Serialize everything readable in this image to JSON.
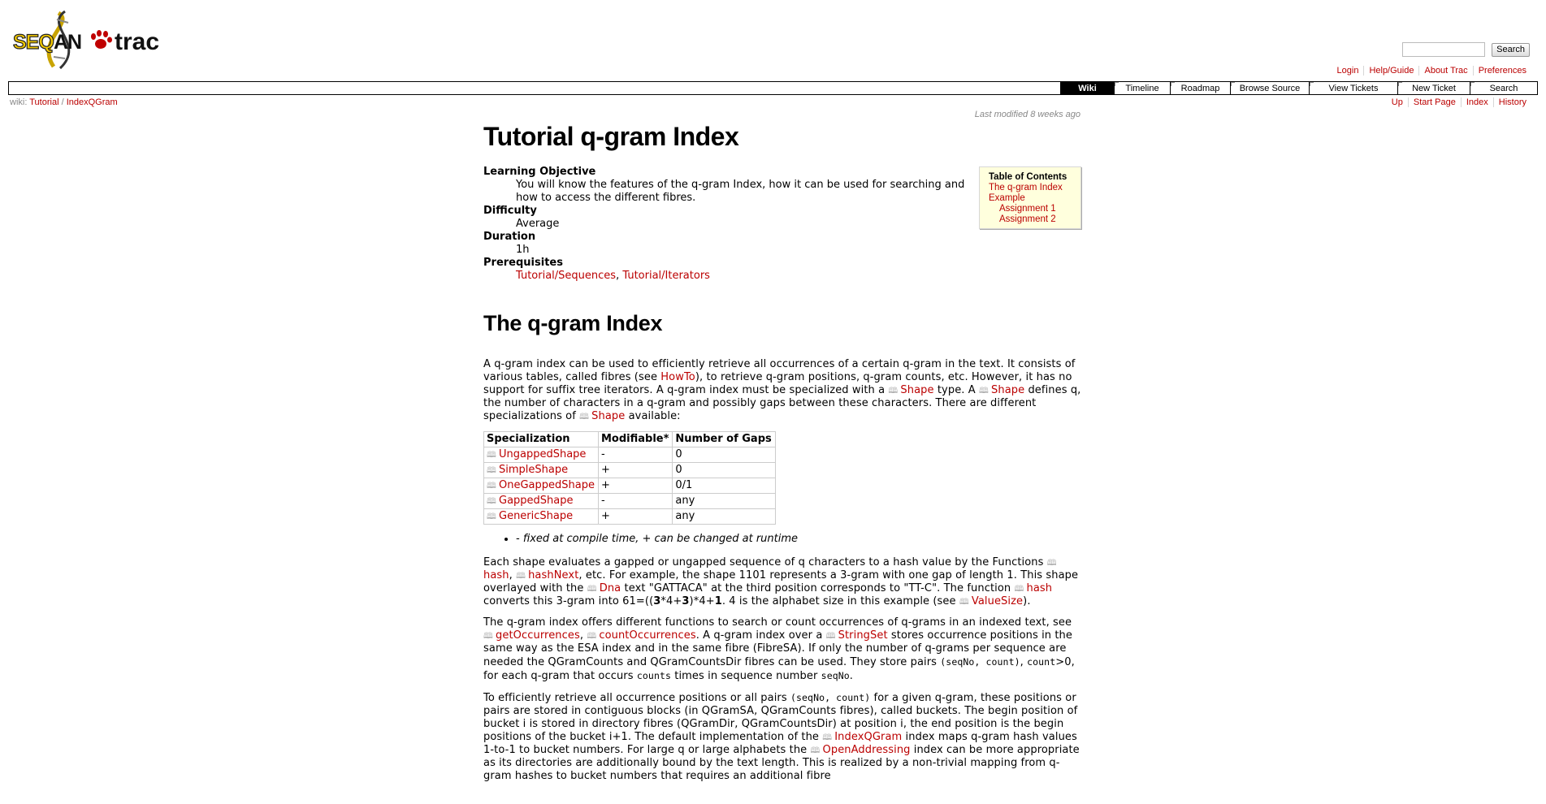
{
  "header": {
    "logo": {
      "text_left": "SEQAN",
      "text_right": "trac"
    },
    "search": {
      "placeholder": "",
      "button": "Search"
    },
    "metanav": [
      "Login",
      "Help/Guide",
      "About Trac",
      "Preferences"
    ],
    "mainnav": [
      {
        "label": "Wiki",
        "active": true
      },
      {
        "label": "Timeline"
      },
      {
        "label": "Roadmap"
      },
      {
        "label": "Browse Source"
      },
      {
        "label": "View Tickets"
      },
      {
        "label": "New Ticket"
      },
      {
        "label": "Search"
      }
    ],
    "breadcrumb": {
      "prefix": "wiki:",
      "path1": "Tutorial",
      "sep": "/",
      "path2": "IndexQGram"
    },
    "ctxnav": [
      "Up",
      "Start Page",
      "Index",
      "History"
    ],
    "last_modified": "Last modified 8 weeks ago"
  },
  "page": {
    "title": "Tutorial q-gram Index",
    "meta": {
      "learning_label": "Learning Objective",
      "learning_text": "You will know the features of the q-gram Index, how it can be used for searching and how to access the different fibres.",
      "difficulty_label": "Difficulty",
      "difficulty": "Average",
      "duration_label": "Duration",
      "duration": "1h",
      "prereq_label": "Prerequisites",
      "prereq_1": "Tutorial/Sequences",
      "prereq_sep": ",",
      "prereq_2": "Tutorial/Iterators"
    },
    "toc": {
      "title": "Table of Contents",
      "items": [
        "The q-gram Index",
        "Example",
        "Assignment 1",
        "Assignment 2"
      ]
    },
    "section_title": "The q-gram Index",
    "p1": {
      "t1": "A q-gram index can be used to efficiently retrieve all occurrences of a certain q-gram in the text. It consists of various tables, called fibres (see ",
      "link_howto": "HowTo",
      "t2": "), to retrieve q-gram positions, q-gram counts, etc. However, it has no support for suffix tree iterators. A q-gram index must be specialized with a ",
      "link_shape": "Shape",
      "t3": " type. A ",
      "t4": " defines q, the number of characters in a q-gram and possibly gaps between these characters. There are different specializations of ",
      "t5": " available:"
    },
    "table": {
      "headers": [
        "Specialization",
        "Modifiable*",
        "Number of Gaps"
      ],
      "rows": [
        [
          "UngappedShape",
          "-",
          "0"
        ],
        [
          "SimpleShape",
          "+",
          "0"
        ],
        [
          "OneGappedShape",
          "+",
          "0/1"
        ],
        [
          "GappedShape",
          "-",
          "any"
        ],
        [
          "GenericShape",
          "+",
          "any"
        ]
      ]
    },
    "note": "- fixed at compile time, + can be changed at runtime",
    "p2": {
      "t1": "Each shape evaluates a gapped or ungapped sequence of q characters to a hash value by the Functions ",
      "link_hash": "hash",
      "comma": ",",
      "link_hashnext": "hashNext",
      "t2": ", etc. For example, the shape 1101 represents a 3-gram with one gap of length 1. This shape overlayed with the ",
      "link_dna": "Dna",
      "t3": " text \"GATTACA\" at the third position corresponds to \"TT-C\". The function ",
      "t4": " converts this 3-gram into 61=((",
      "b1": "3",
      "t5": "*4+",
      "b2": "3",
      "t6": ")*4+",
      "b3": "1",
      "t7": ". 4 is the alphabet size in this example (see ",
      "link_valuesize": "ValueSize",
      "t8": ")."
    },
    "p3": {
      "t1": "The q-gram index offers different functions to search or count occurrences of q-grams in an indexed text, see ",
      "link_getocc": "getOccurrences",
      "comma": ",",
      "link_countocc": "countOccurrences",
      "t2": ". A q-gram index over a ",
      "link_stringset": "StringSet",
      "t3": " stores occurrence positions in the same way as the ESA index and in the same fibre (FibreSA). If only the number of q-grams per sequence are needed the QGramCounts and QGramCountsDir fibres can be used. They store pairs ",
      "c1": "(seqNo, count)",
      "t4": ", ",
      "c2": "count",
      "t5": ">0, for each q-gram that occurs ",
      "c3": "counts",
      "t6": " times in sequence number ",
      "c4": "seqNo",
      "t7": "."
    },
    "p4": {
      "t1": "To efficiently retrieve all occurrence positions or all pairs ",
      "c1": "(seqNo, count)",
      "t2": " for a given q-gram, these positions or pairs are stored in contiguous blocks (in QGramSA, QGramCounts fibres), called buckets. The begin position of bucket i is stored in directory fibres (QGramDir, QGramCountsDir) at position i, the end position is the begin positions of the bucket i+1. The default implementation of the ",
      "link_indexqgram": "IndexQGram",
      "t3": " index maps q-gram hash values 1-to-1 to bucket numbers. For large q or large alphabets the ",
      "link_openaddr": "OpenAddressing",
      "t4": " index can be more appropriate as its directories are additionally bound by the text length. This is realized by a non-trivial mapping from q-gram hashes to bucket numbers that requires an additional fibre"
    },
    "colors": {
      "link": "#bb0000",
      "toc_bg": "#ffffdd",
      "logo_yellow": "#f2c800"
    }
  }
}
